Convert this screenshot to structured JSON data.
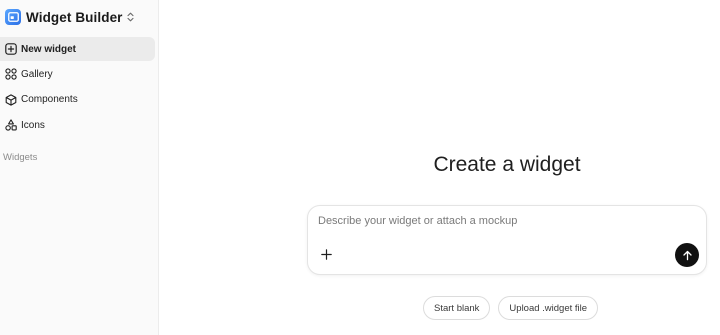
{
  "sidebar": {
    "brand": {
      "title": "Widget Builder",
      "logo_icon": "widget-window-icon",
      "switcher_icon": "chevron-updown-icon"
    },
    "items": [
      {
        "label": "New widget",
        "icon": "plus-square-icon",
        "active": true
      },
      {
        "label": "Gallery",
        "icon": "grid-icon",
        "active": false
      },
      {
        "label": "Components",
        "icon": "cube-icon",
        "active": false
      },
      {
        "label": "Icons",
        "icon": "shapes-icon",
        "active": false
      }
    ],
    "section_label": "Widgets"
  },
  "main": {
    "title": "Create a widget",
    "composer": {
      "placeholder": "Describe your widget or attach a mockup",
      "value": "",
      "attach_icon": "plus-icon",
      "send_icon": "arrow-up-icon"
    },
    "actions": [
      {
        "label": "Start blank"
      },
      {
        "label": "Upload .widget file"
      }
    ]
  },
  "colors": {
    "brand_gradient_start": "#5aa7ff",
    "brand_gradient_end": "#2b6fe6",
    "send_button": "#111111",
    "active_item_bg": "#ebebeb"
  }
}
